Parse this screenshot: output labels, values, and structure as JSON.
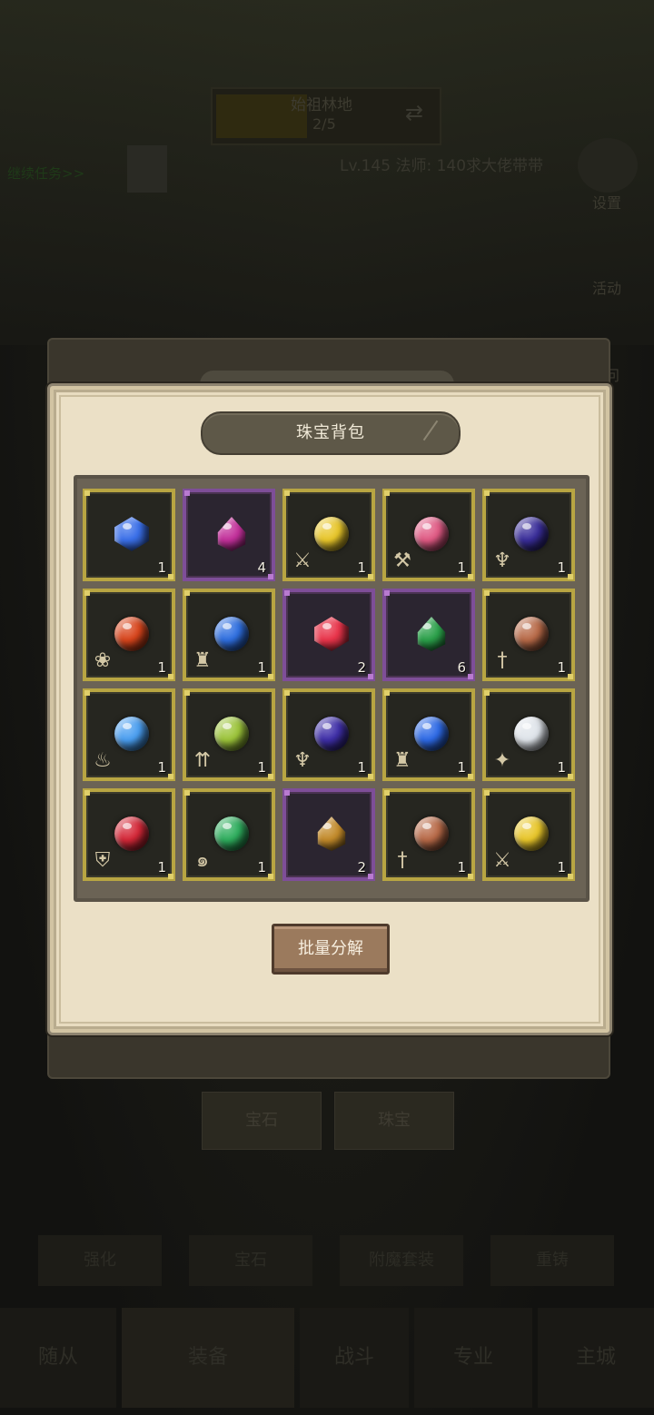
{
  "background": {
    "stage_title": "始祖林地",
    "stage_progress": "2/5",
    "task_text": "继续任务>>",
    "player_info": "Lv.145 法师: 140求大佬带带",
    "side_buttons": [
      "设置",
      "活动",
      "问"
    ],
    "bottom_tabs": [
      "宝石",
      "珠宝"
    ],
    "action_buttons": [
      "强化",
      "宝石",
      "附魔套装",
      "重铸"
    ],
    "nav_items": [
      "随从",
      "装备",
      "战斗",
      "专业",
      "主城"
    ]
  },
  "modal": {
    "title": "珠宝背包",
    "decompose_button": "批量分解",
    "slots": [
      {
        "color": "#3a6fe8",
        "shape": "cut",
        "frame": "gold",
        "badge": "",
        "count": "1"
      },
      {
        "color": "#c2309a",
        "shape": "drop",
        "frame": "purple",
        "badge": "",
        "count": "4"
      },
      {
        "color": "#e8c62a",
        "shape": "orb",
        "frame": "gold",
        "badge": "swords",
        "count": "1"
      },
      {
        "color": "#e05a84",
        "shape": "orb",
        "frame": "gold",
        "badge": "hammer",
        "count": "1"
      },
      {
        "color": "#3a2e9a",
        "shape": "orb",
        "frame": "gold",
        "badge": "horns",
        "count": "1"
      },
      {
        "color": "#d8451c",
        "shape": "orb",
        "frame": "gold",
        "badge": "paw",
        "count": "1"
      },
      {
        "color": "#2f6fe0",
        "shape": "orb",
        "frame": "gold",
        "badge": "totem",
        "count": "1"
      },
      {
        "color": "#e8344a",
        "shape": "cut",
        "frame": "purple",
        "badge": "",
        "count": "2"
      },
      {
        "color": "#2ba04a",
        "shape": "drop",
        "frame": "purple",
        "badge": "",
        "count": "6"
      },
      {
        "color": "#b86a48",
        "shape": "orb",
        "frame": "gold",
        "badge": "dagger",
        "count": "1"
      },
      {
        "color": "#4a9ef0",
        "shape": "orb",
        "frame": "gold",
        "badge": "flame",
        "count": "1"
      },
      {
        "color": "#9cc43a",
        "shape": "orb",
        "frame": "gold",
        "badge": "arrows",
        "count": "1"
      },
      {
        "color": "#3f2fa8",
        "shape": "orb",
        "frame": "gold",
        "badge": "horns",
        "count": "1"
      },
      {
        "color": "#2e6ae6",
        "shape": "orb",
        "frame": "gold",
        "badge": "totem",
        "count": "1"
      },
      {
        "color": "#dfe4ea",
        "shape": "orb",
        "frame": "gold",
        "badge": "star",
        "count": "1"
      },
      {
        "color": "#d42838",
        "shape": "orb",
        "frame": "gold",
        "badge": "shield",
        "count": "1"
      },
      {
        "color": "#2fae5e",
        "shape": "orb",
        "frame": "gold",
        "badge": "swirl",
        "count": "1"
      },
      {
        "color": "#c28a2a",
        "shape": "drop",
        "frame": "purple",
        "badge": "",
        "count": "2"
      },
      {
        "color": "#b86a48",
        "shape": "orb",
        "frame": "gold",
        "badge": "dagger",
        "count": "1"
      },
      {
        "color": "#e8c62a",
        "shape": "orb",
        "frame": "gold",
        "badge": "swords",
        "count": "1"
      }
    ]
  }
}
